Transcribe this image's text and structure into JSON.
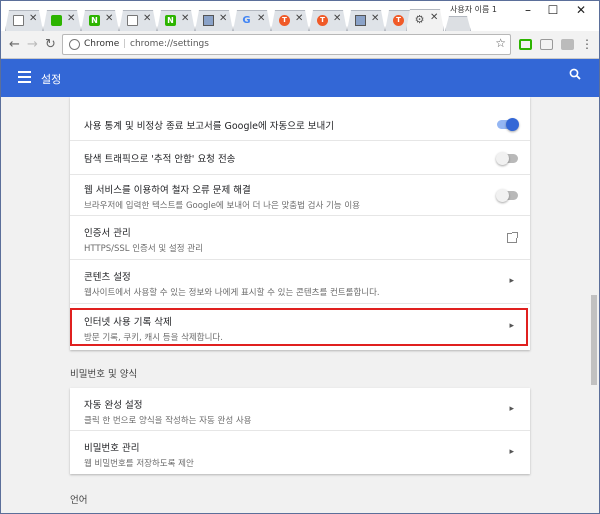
{
  "browser": {
    "tabs": [
      {
        "icon": "document-icon",
        "close": "✕"
      },
      {
        "icon": "naver-green-icon",
        "close": "✕"
      },
      {
        "icon": "naver-n-icon",
        "label": "N",
        "close": "✕"
      },
      {
        "icon": "document-icon",
        "close": "✕"
      },
      {
        "icon": "naver-n-icon",
        "label": "N",
        "close": "✕"
      },
      {
        "icon": "image-icon",
        "close": "✕"
      },
      {
        "icon": "google-icon",
        "label": "G",
        "close": "✕"
      },
      {
        "icon": "tistory-icon",
        "label": "T",
        "close": "✕"
      },
      {
        "icon": "tistory-icon",
        "label": "T",
        "close": "✕"
      },
      {
        "icon": "image-icon",
        "close": "✕"
      },
      {
        "icon": "tistory-icon",
        "label": "T",
        "close": "✕"
      },
      {
        "icon": "settings-gear-icon",
        "label": "⚙",
        "close": "✕"
      }
    ],
    "profile_name": "사용자 이름 1",
    "window_controls": {
      "minimize": "–",
      "maximize": "☐",
      "close": "✕"
    },
    "nav": {
      "back": "←",
      "forward": "→",
      "reload": "↻"
    },
    "omnibox": {
      "scheme_label": "Chrome",
      "separator": "|",
      "url": "chrome://settings",
      "star": "☆"
    },
    "menu": "⋮"
  },
  "header": {
    "title": "설정",
    "search_glyph": "🔍",
    "accent_color": "#3367d6"
  },
  "privacy_card": {
    "rows": [
      {
        "title": "사용 통계 및 비정상 종료 보고서를 Google에 자동으로 보내기",
        "toggle": true
      },
      {
        "title": "탐색 트래픽으로 '추적 안함' 요청 전송",
        "toggle": false
      },
      {
        "title": "웹 서비스를 이용하여 철자 오류 문제 해결",
        "subtitle": "브라우저에 입력한 텍스트를 Google에 보내어 더 나은 맞춤법 검사 기능 이용",
        "toggle": false
      },
      {
        "title": "인증서 관리",
        "subtitle": "HTTPS/SSL 인증서 및 설정 관리",
        "action": "external-link"
      },
      {
        "title": "콘텐츠 설정",
        "subtitle": "웹사이트에서 사용할 수 있는 정보와 나에게 표시할 수 있는 콘텐츠를 컨트롤합니다.",
        "action": "chevron"
      },
      {
        "title": "인터넷 사용 기록 삭제",
        "subtitle": "방문 기록, 쿠키, 캐시 등을 삭제합니다.",
        "action": "chevron",
        "highlighted": true
      }
    ]
  },
  "passwords_section": {
    "label": "비밀번호 및 양식",
    "rows": [
      {
        "title": "자동 완성 설정",
        "subtitle": "클릭 한 번으로 양식을 작성하는 자동 완성 사용",
        "action": "chevron"
      },
      {
        "title": "비밀번호 관리",
        "subtitle": "웹 비밀번호를 저장하도록 제안",
        "action": "chevron"
      }
    ]
  },
  "language_section": {
    "label": "언어"
  },
  "chevron_glyph": "▸",
  "highlight_color": "#e0201f"
}
